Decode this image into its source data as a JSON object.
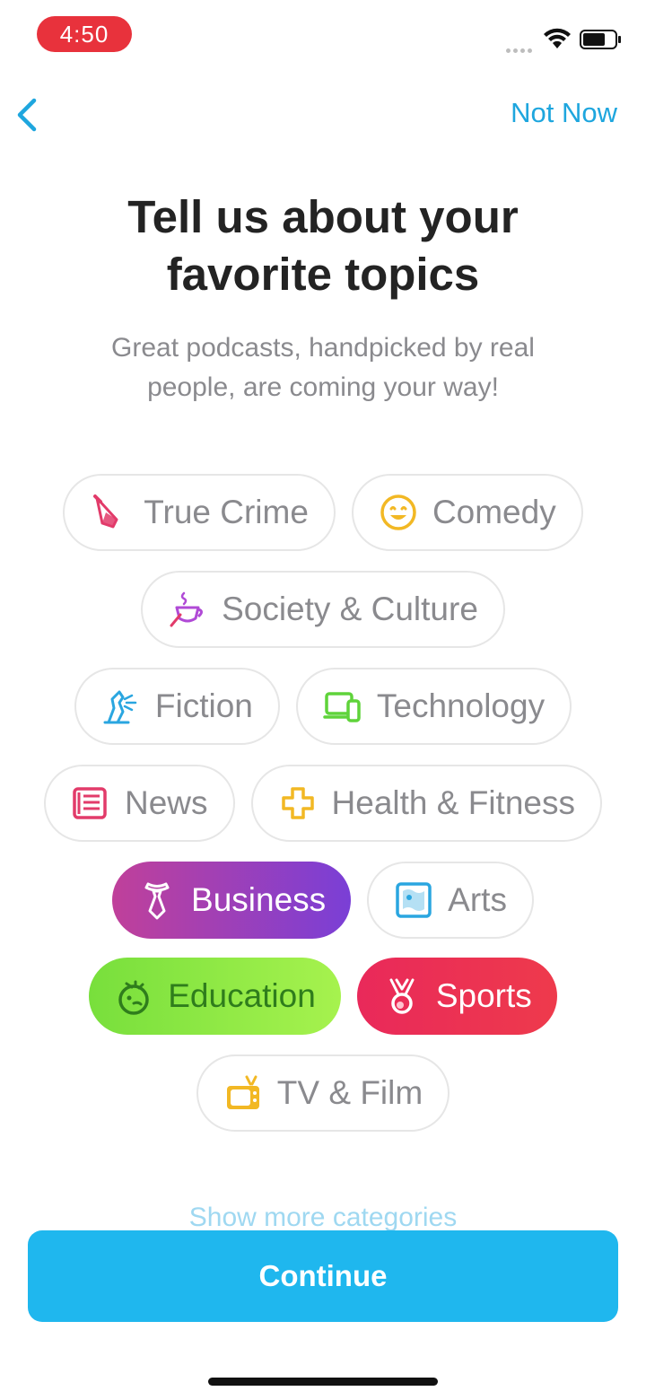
{
  "status_bar": {
    "time": "4:50",
    "icons": [
      "signal-dots-icon",
      "wifi-icon",
      "battery-icon"
    ]
  },
  "nav": {
    "back_icon": "chevron-left-icon",
    "not_now_label": "Not Now"
  },
  "header": {
    "title": "Tell us about your favorite topics",
    "subtitle": "Great podcasts, handpicked by real people, are coming your way!"
  },
  "topics": [
    {
      "label": "True Crime",
      "icon": "knife-icon",
      "selected": false
    },
    {
      "label": "Comedy",
      "icon": "smiley-icon",
      "selected": false
    },
    {
      "label": "Society & Culture",
      "icon": "teacup-icon",
      "selected": false
    },
    {
      "label": "Fiction",
      "icon": "dragon-icon",
      "selected": false
    },
    {
      "label": "Technology",
      "icon": "devices-icon",
      "selected": false
    },
    {
      "label": "News",
      "icon": "newspaper-icon",
      "selected": false
    },
    {
      "label": "Health & Fitness",
      "icon": "plus-cross-icon",
      "selected": false
    },
    {
      "label": "Business",
      "icon": "necktie-icon",
      "selected": true
    },
    {
      "label": "Arts",
      "icon": "painting-icon",
      "selected": false
    },
    {
      "label": "Education",
      "icon": "brain-icon",
      "selected": true
    },
    {
      "label": "Sports",
      "icon": "medal-icon",
      "selected": true
    },
    {
      "label": "TV & Film",
      "icon": "tv-icon",
      "selected": false
    }
  ],
  "footer": {
    "show_more_label": "Show more categories",
    "continue_label": "Continue"
  },
  "colors": {
    "accent": "#1fb7ee",
    "link": "#1ea6de",
    "business_gradient": [
      "#c0409a",
      "#7a3fd6"
    ],
    "education_gradient": [
      "#78df3c",
      "#a6f24e"
    ],
    "sports_gradient": [
      "#e9295a",
      "#ee3a4c"
    ]
  }
}
